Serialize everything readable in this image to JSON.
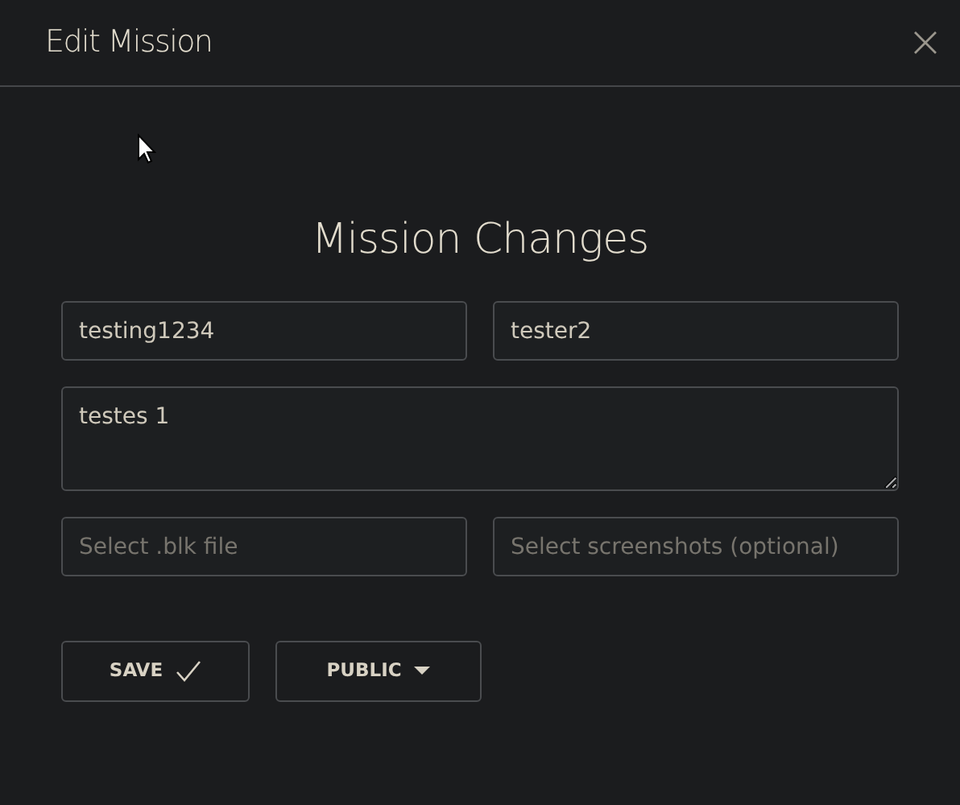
{
  "window": {
    "title": "Edit Mission"
  },
  "heading": "Mission Changes",
  "fields": [
    {
      "kind": "input",
      "value": "testing1234"
    },
    {
      "kind": "input",
      "value": "tester2"
    },
    {
      "kind": "textarea",
      "value": "testes 1"
    },
    {
      "kind": "file",
      "placeholder": "Select .blk file"
    },
    {
      "kind": "file",
      "placeholder": "Select screenshots (optional)"
    }
  ],
  "buttons": [
    {
      "kind": "save",
      "label": "SAVE"
    },
    {
      "kind": "dropdown",
      "label": "PUBLIC"
    }
  ]
}
